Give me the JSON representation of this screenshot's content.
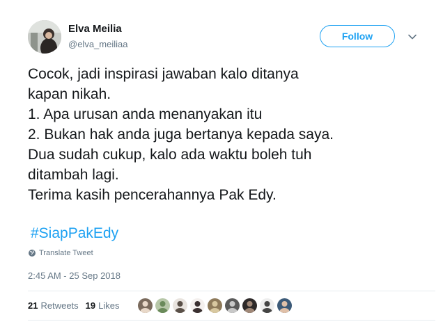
{
  "author": {
    "display_name": "Elva Meilia",
    "handle": "@elva_meiliaa"
  },
  "follow_button": {
    "label": "Follow"
  },
  "tweet": {
    "text": "Cocok, jadi inspirasi jawaban kalo ditanya\nkapan nikah.\n1. Apa urusan anda menanyakan itu\n2. Bukan hak anda juga bertanya kepada saya.\nDua sudah cukup, kalo ada waktu boleh tuh\nditambah lagi.\nTerima kasih pencerahannya Pak Edy.",
    "hashtag": "#SiapPakEdy",
    "translate_label": "Translate Tweet",
    "timestamp": "2:45 AM - 25 Sep 2018"
  },
  "stats": {
    "retweets_count": "21",
    "retweets_label": "Retweets",
    "likes_count": "19",
    "likes_label": "Likes"
  },
  "likers": [
    {
      "bg": "#7a6a5c",
      "fg": "#e8d8c8"
    },
    {
      "bg": "#b7c7a8",
      "fg": "#6a8a5a"
    },
    {
      "bg": "#e9e4df",
      "fg": "#5a5048"
    },
    {
      "bg": "#f4f0ee",
      "fg": "#3a3030"
    },
    {
      "bg": "#8e7a5a",
      "fg": "#d8c8a0"
    },
    {
      "bg": "#5a5a5a",
      "fg": "#c8c8c8"
    },
    {
      "bg": "#2e2a2a",
      "fg": "#a08878"
    },
    {
      "bg": "#eeeeee",
      "fg": "#444444"
    },
    {
      "bg": "#3c5a78",
      "fg": "#e0c0a8"
    }
  ],
  "colors": {
    "accent": "#1da1f2",
    "text": "#14171a",
    "muted": "#657786",
    "divider": "#e6ecf0"
  },
  "icons": {
    "caret": "chevron-down-icon",
    "globe": "globe-icon"
  }
}
